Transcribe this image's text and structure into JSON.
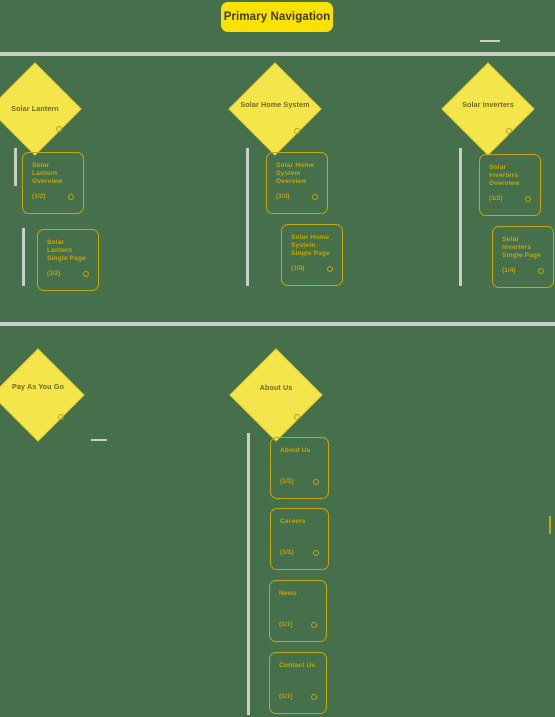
{
  "header": {
    "title": "Primary Navigation"
  },
  "diagram": {
    "type": "sitemap",
    "background_color": "#46704b",
    "node_fill_color": "#f4e64a",
    "node_stroke_color": "#c3a60a",
    "divider_color": "#c9cfc6",
    "accent_color": "#fbe100"
  },
  "sections": [
    {
      "id": "products",
      "branches": [
        {
          "id": "solar-lantern",
          "category": "Solar Lantern",
          "pages": [
            {
              "title": "Solar Lantern Overview",
              "count": "(1/2)"
            },
            {
              "title": "Solar Lantern Single Page",
              "count": "(1/2)"
            }
          ]
        },
        {
          "id": "solar-home-system",
          "category": "Solar Home System",
          "pages": [
            {
              "title": "Solar Home System Overview",
              "count": "(1/3)"
            },
            {
              "title": "Solar Home System Single Page",
              "count": "(1/3)"
            }
          ]
        },
        {
          "id": "solar-inverters",
          "category": "Solar Inverters",
          "pages": [
            {
              "title": "Solar Inverters Overview",
              "count": "(1/2)"
            },
            {
              "title": "Solar Inverters Single Page",
              "count": "(1/4)"
            }
          ]
        }
      ]
    },
    {
      "id": "company",
      "branches": [
        {
          "id": "pay-as-you-go",
          "category": "Pay As You Go",
          "pages": []
        },
        {
          "id": "about-us",
          "category": "About Us",
          "pages": [
            {
              "title": "About Us",
              "count": "(1/1)"
            },
            {
              "title": "Careers",
              "count": "(1/1)"
            },
            {
              "title": "News",
              "count": "(1/1)"
            },
            {
              "title": "Contact Us",
              "count": "(1/1)"
            }
          ]
        }
      ]
    }
  ]
}
